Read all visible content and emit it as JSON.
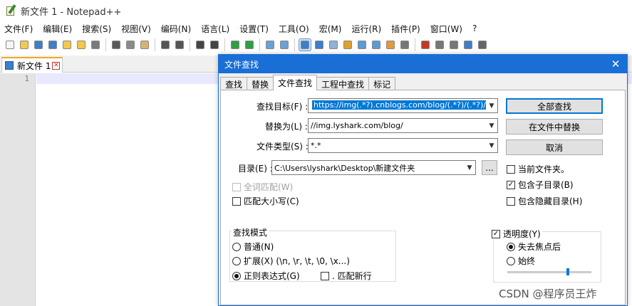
{
  "window": {
    "title": "新文件 1 - Notepad++"
  },
  "menu": [
    "文件(F)",
    "编辑(E)",
    "搜索(S)",
    "视图(V)",
    "编码(N)",
    "语言(L)",
    "设置(T)",
    "工具(O)",
    "宏(M)",
    "运行(R)",
    "插件(P)",
    "窗口(W)",
    "?"
  ],
  "toolbar": {
    "icons": [
      "new-file-icon",
      "open-file-icon",
      "save-icon",
      "save-all-icon",
      "close-icon",
      "close-all-icon",
      "print-icon",
      "cut-icon",
      "copy-icon",
      "paste-icon",
      "undo-icon",
      "redo-icon",
      "find-icon",
      "replace-icon",
      "zoom-in-icon",
      "zoom-out-icon",
      "sync-vertical-icon",
      "sync-horizontal-icon",
      "word-wrap-icon",
      "show-all-chars-icon",
      "indent-guide-icon",
      "user-defined-lang-icon",
      "doc-map-icon",
      "function-list-icon",
      "folder-as-workspace-icon",
      "monitoring-icon",
      "record-macro-icon",
      "stop-macro-icon",
      "play-macro-icon",
      "run-macro-multiple-icon",
      "save-macro-icon"
    ]
  },
  "doc_tab": {
    "label": "新文件 1"
  },
  "editor": {
    "line_number": "1"
  },
  "dialog": {
    "title": "文件查找",
    "tabs": [
      "查找",
      "替换",
      "文件查找",
      "工程中查找",
      "标记"
    ],
    "active_tab": 2,
    "find_label": "查找目标(F) :",
    "find_value": "https://img(.*?).cnblogs.com/blog/(.*?)/(.*?)/",
    "replace_label": "替换为(L) :",
    "replace_value": "//img.lyshark.com/blog/",
    "filter_label": "文件类型(S) :",
    "filter_value": "*.*",
    "dir_label": "目录(E) :",
    "dir_value": "C:\\Users\\lyshark\\Desktop\\新建文件夹",
    "browse_label": "...",
    "find_all_button": "全部查找",
    "replace_in_files_button": "在文件中替换",
    "cancel_button": "取消",
    "follow_current_doc": "当前文件夹。",
    "in_subfolders": "包含子目录(B)",
    "in_hidden_folders": "包含隐藏目录(H)",
    "whole_word": "全词匹配(W)",
    "match_case": "匹配大小写(C)",
    "search_mode_title": "查找模式",
    "mode_normal": "普通(N)",
    "mode_extended": "扩展(X) (\\n, \\r, \\t, \\0, \\x...)",
    "mode_regex": "正则表达式(G)",
    "dot_newline": ". 匹配新行",
    "transparency_label": "透明度(Y)",
    "on_losing_focus": "失去焦点后",
    "always": "始终",
    "transparency_level": 0.72
  },
  "watermark": "CSDN @程序员王炸",
  "colors": {
    "accent": "#0078d7",
    "dialog_title": "#1a6fd6",
    "tab_accent": "#f5a623"
  }
}
